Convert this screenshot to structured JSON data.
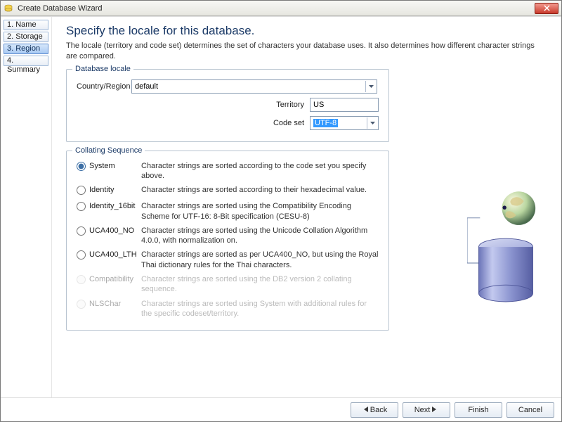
{
  "window": {
    "title": "Create Database Wizard"
  },
  "sidebar": {
    "steps": [
      {
        "label": "1. Name"
      },
      {
        "label": "2. Storage"
      },
      {
        "label": "3. Region"
      },
      {
        "label": "4. Summary"
      }
    ],
    "active_index": 2
  },
  "page": {
    "heading": "Specify the locale for this database.",
    "description": "The locale (territory and code set) determines the set of characters your database uses. It also determines how different character strings are compared."
  },
  "locale_group": {
    "legend": "Database locale",
    "country_region_label": "Country/Region",
    "country_region_value": "default",
    "territory_label": "Territory",
    "territory_value": "US",
    "code_set_label": "Code set",
    "code_set_value": "UTF-8"
  },
  "collating_group": {
    "legend": "Collating Sequence",
    "selected": "system",
    "options": [
      {
        "id": "system",
        "label": "System",
        "desc": "Character strings are sorted according to the code set you specify above.",
        "enabled": true
      },
      {
        "id": "identity",
        "label": "Identity",
        "desc": "Character strings are sorted according to their hexadecimal value.",
        "enabled": true
      },
      {
        "id": "identity16",
        "label": "Identity_16bit",
        "desc": "Character strings are sorted using the Compatibility Encoding Scheme for UTF-16: 8-Bit specification (CESU-8)",
        "enabled": true
      },
      {
        "id": "uca400no",
        "label": "UCA400_NO",
        "desc": "Character strings are sorted using the Unicode Collation Algorithm 4.0.0, with normalization on.",
        "enabled": true
      },
      {
        "id": "uca400lth",
        "label": "UCA400_LTH",
        "desc": "Character strings are sorted as per UCA400_NO, but using the Royal Thai dictionary rules for the Thai characters.",
        "enabled": true
      },
      {
        "id": "compatibility",
        "label": "Compatibility",
        "desc": "Character strings are sorted using the DB2 version 2 collating sequence.",
        "enabled": false
      },
      {
        "id": "nlschar",
        "label": "NLSChar",
        "desc": "Character strings are sorted using System with additional rules for the specific codeset/territory.",
        "enabled": false
      }
    ]
  },
  "buttons": {
    "back": "Back",
    "next": "Next",
    "finish": "Finish",
    "cancel": "Cancel"
  }
}
